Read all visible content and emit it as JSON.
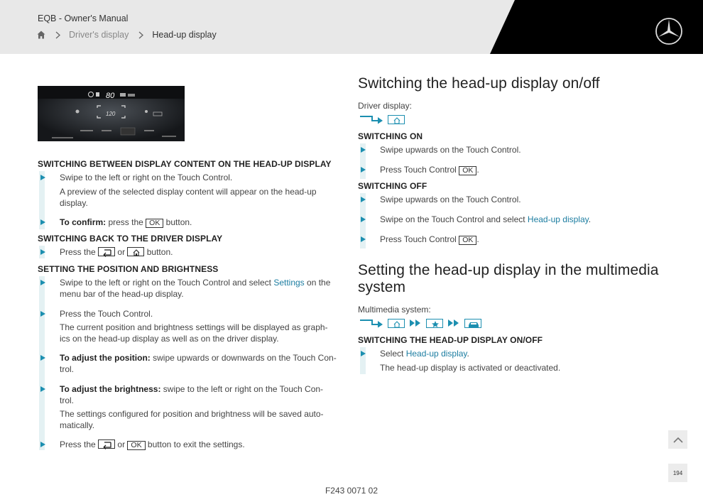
{
  "header": {
    "manual_title": "EQB - Owner's Manual",
    "breadcrumb": [
      "Driver's display",
      "Head-up display"
    ]
  },
  "hud_image": {
    "speed": "80",
    "set_speed": "120"
  },
  "left": {
    "sec1": {
      "heading": "SWITCHING BETWEEN DISPLAY CONTENT ON THE HEAD-UP DISPLAY",
      "step1": "Swipe to the left or right on the Touch Control.",
      "step1_result": "A preview of the selected display content will appear on the head-up display.",
      "step2_bold": "To confirm:",
      "step2_text": "press the",
      "step2_key": "OK",
      "step2_tail": "button."
    },
    "sec2": {
      "heading": "SWITCHING BACK TO THE DRIVER DISPLAY",
      "pre": "Press the",
      "or": "or",
      "tail": "button."
    },
    "sec3": {
      "heading": "SETTING THE POSITION AND BRIGHTNESS",
      "step1_pre": "Swipe to the left or right on the Touch Control and select",
      "step1_link": "Settings",
      "step1_tail": "on the menu bar of the head-up display.",
      "step2": "Press the Touch Control.",
      "step2_result": "The current position and brightness settings will be displayed as graph-ics on the head-up display as well as on the driver display.",
      "step3_bold": "To adjust the position:",
      "step3_text": "swipe upwards or downwards on the Touch Con-trol.",
      "step4_bold": "To adjust the brightness:",
      "step4_text": "swipe to the left or right on the Touch Con-trol.",
      "step4_result": "The settings configured for position and brightness will be saved auto-matically.",
      "step5_pre": "Press the",
      "step5_or": "or",
      "step5_key": "OK",
      "step5_tail": "button to exit the settings."
    }
  },
  "right": {
    "title1": "Switching the head-up display on/off",
    "driver_display_label": "Driver display:",
    "on": {
      "heading": "SWITCHING ON",
      "step1": "Swipe upwards on the Touch Control.",
      "step2_pre": "Press Touch Control",
      "step2_key": "OK",
      "step2_tail": "."
    },
    "off": {
      "heading": "SWITCHING OFF",
      "step1": "Swipe upwards on the Touch Control.",
      "step2_pre": "Swipe on the Touch Control and select",
      "step2_link": "Head-up display",
      "step2_tail": ".",
      "step3_pre": "Press Touch Control",
      "step3_key": "OK",
      "step3_tail": "."
    },
    "title2": "Setting the head-up display in the multimedia system",
    "multimedia_label": "Multimedia system:",
    "mm": {
      "heading": "SWITCHING THE HEAD-UP DISPLAY ON/OFF",
      "step1_pre": "Select",
      "step1_link": "Head-up display",
      "step1_tail": ".",
      "result": "The head-up display is activated or deactivated."
    }
  },
  "footer": {
    "code": "F243 0071 02"
  },
  "page_number": "194",
  "colors": {
    "accent": "#1c8fb0",
    "link": "#1c7da1",
    "bar": "#e4f1f3",
    "header_bg": "#e8e8e8"
  }
}
